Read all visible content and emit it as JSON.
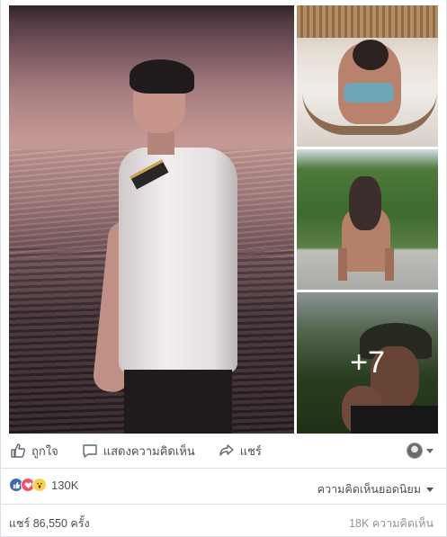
{
  "photos": {
    "more_count": "+7"
  },
  "actions": {
    "like": "ถูกใจ",
    "comment": "แสดงความคิดเห็น",
    "share": "แชร์"
  },
  "reactions": {
    "types": [
      "like",
      "love",
      "wow"
    ],
    "count": "130K",
    "sort_label": "ความคิดเห็นยอดนิยม"
  },
  "stats": {
    "shares": "แชร์ 86,550 ครั้ง",
    "comments": "18K ความคิดเห็น"
  },
  "colors": {
    "like_blue": "#4267b2",
    "love_red": "#f25268",
    "wow_yellow": "#fbd14b",
    "text_gray": "#4b4f56"
  }
}
